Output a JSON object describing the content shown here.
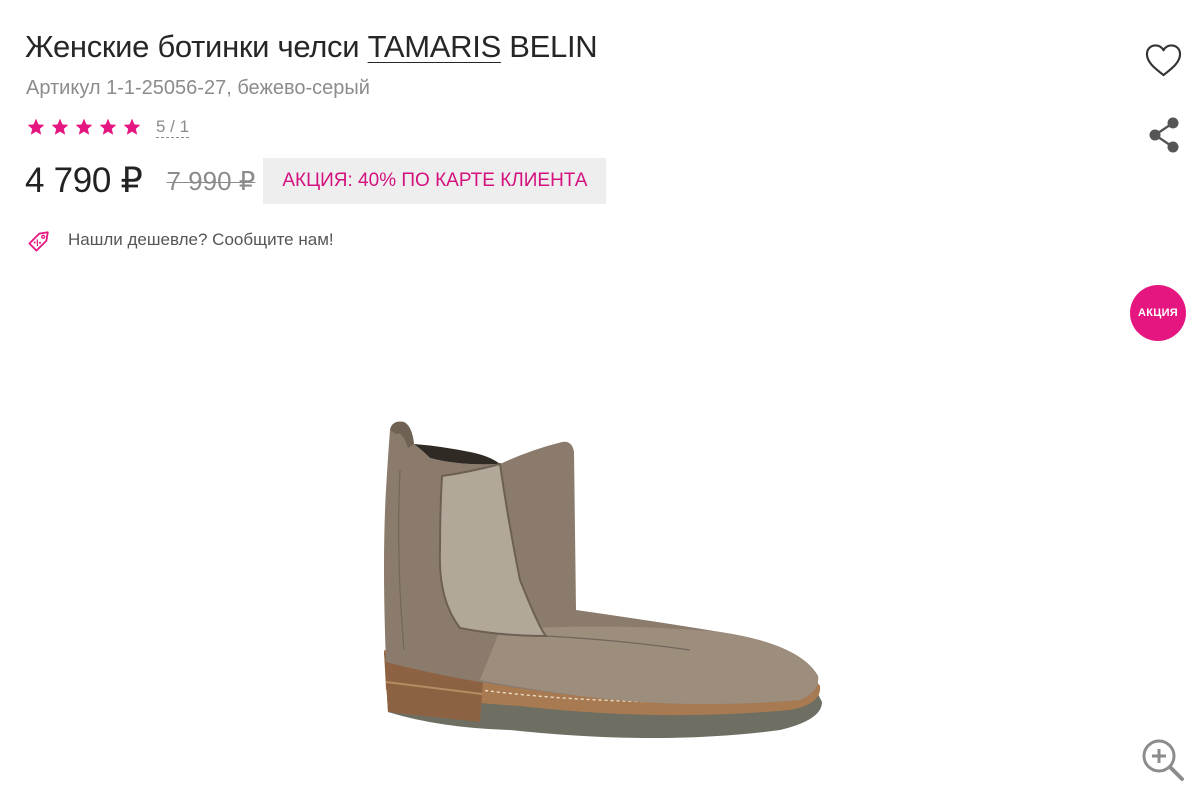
{
  "product": {
    "title_prefix": "Женские ботинки челси ",
    "brand": "TAMARIS",
    "model": " BELIN",
    "sku": "Артикул 1-1-25056-27, бежево-серый"
  },
  "rating": {
    "stars": 5,
    "count_label": "5 / 1"
  },
  "price": {
    "current": "4 790 ₽",
    "old": "7 990 ₽",
    "promo": "АКЦИЯ: 40% ПО КАРТЕ КЛИЕНТА"
  },
  "cheaper": {
    "label": "Нашли дешевле? Сообщите нам!"
  },
  "badge": {
    "label": "АКЦИЯ"
  },
  "icons": {
    "favorite": "heart-icon",
    "share": "share-icon",
    "zoom": "zoom-in-icon",
    "price_tag": "discount-tag-icon",
    "star": "star-icon"
  },
  "colors": {
    "accent": "#e5167f",
    "promo_text": "#d4117f",
    "promo_bg": "#eeeeee",
    "muted": "#8c8c8c"
  }
}
